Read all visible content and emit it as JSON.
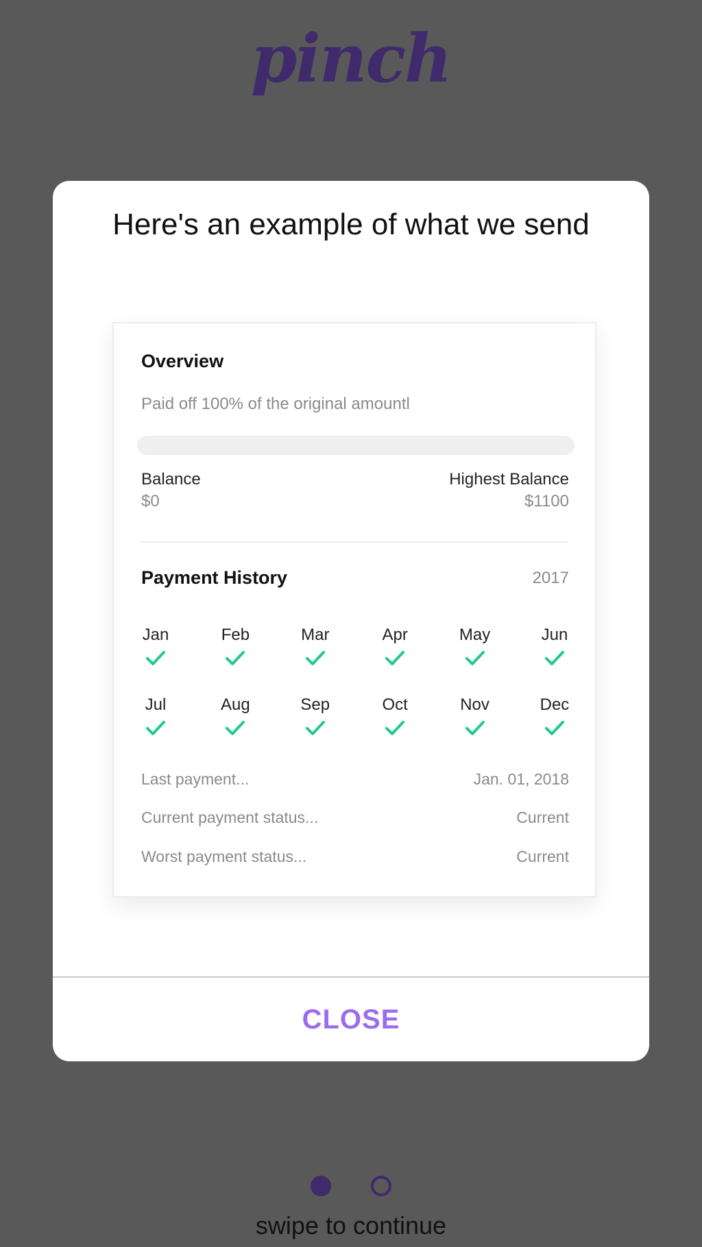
{
  "app": {
    "logo_text": "pinch"
  },
  "modal": {
    "title": "Here's an example of what we send",
    "close_label": "CLOSE"
  },
  "overview": {
    "title": "Overview",
    "description": "Paid off 100% of the original amountl",
    "paid_off_fraction": 1.0,
    "balance_label": "Balance",
    "balance_value": "$0",
    "highest_balance_label": "Highest Balance",
    "highest_balance_value": "$1100"
  },
  "payment_history": {
    "title": "Payment History",
    "year": "2017",
    "months_row1": [
      "Jan",
      "Feb",
      "Mar",
      "Apr",
      "May",
      "Jun"
    ],
    "months_row2": [
      "Jul",
      "Aug",
      "Sep",
      "Oct",
      "Nov",
      "Dec"
    ],
    "all_paid_icon": "check-icon",
    "check_color": "#1fc98e"
  },
  "details": [
    {
      "label": "Last payment...",
      "value": "Jan. 01, 2018"
    },
    {
      "label": "Current payment status...",
      "value": "Current"
    },
    {
      "label": "Worst payment status...",
      "value": "Current"
    }
  ],
  "pager": {
    "total": 2,
    "active_index": 0
  },
  "footer": {
    "swipe_text": "swipe to continue"
  },
  "colors": {
    "brand": "#3f2a6b",
    "accent": "#9b6cf0",
    "background": "#595959"
  }
}
